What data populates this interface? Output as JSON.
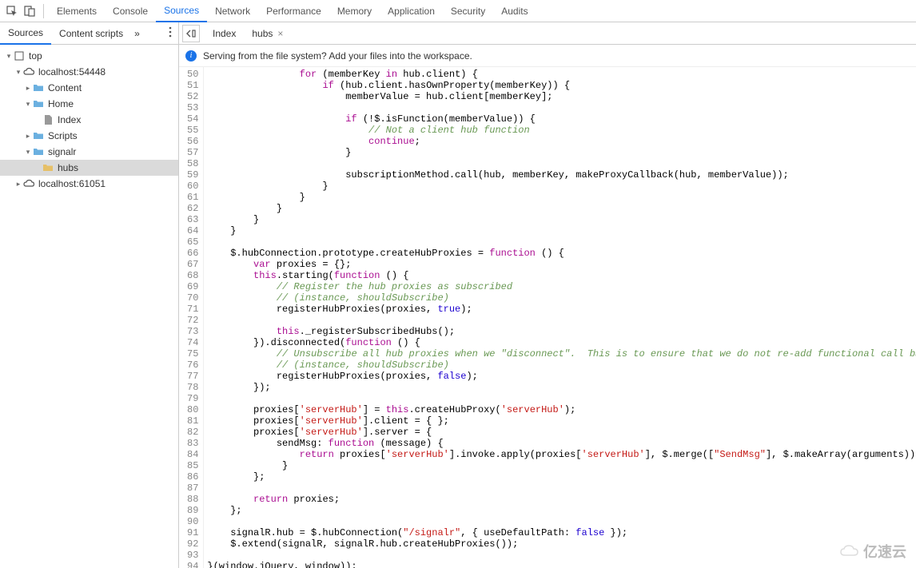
{
  "topbar": {
    "tabs": [
      "Elements",
      "Console",
      "Sources",
      "Network",
      "Performance",
      "Memory",
      "Application",
      "Security",
      "Audits"
    ],
    "active": "Sources"
  },
  "sidebar": {
    "tabs": [
      "Sources",
      "Content scripts"
    ],
    "active": "Sources",
    "more_glyph": "»",
    "tree": [
      {
        "label": "top",
        "indent": 0,
        "arrow": "▾",
        "icon": "frame"
      },
      {
        "label": "localhost:54448",
        "indent": 1,
        "arrow": "▾",
        "icon": "cloud"
      },
      {
        "label": "Content",
        "indent": 2,
        "arrow": "▸",
        "icon": "folder"
      },
      {
        "label": "Home",
        "indent": 2,
        "arrow": "▾",
        "icon": "folder"
      },
      {
        "label": "Index",
        "indent": 3,
        "arrow": "",
        "icon": "file"
      },
      {
        "label": "Scripts",
        "indent": 2,
        "arrow": "▸",
        "icon": "folder"
      },
      {
        "label": "signalr",
        "indent": 2,
        "arrow": "▾",
        "icon": "folder"
      },
      {
        "label": "hubs",
        "indent": 3,
        "arrow": "",
        "icon": "folder-y",
        "selected": true
      },
      {
        "label": "localhost:61051",
        "indent": 1,
        "arrow": "▸",
        "icon": "cloud"
      }
    ]
  },
  "editor": {
    "tabs": [
      {
        "label": "Index",
        "closable": false
      },
      {
        "label": "hubs",
        "closable": true
      }
    ],
    "info_bar": "Serving from the file system? Add your files into the workspace.",
    "first_line": 50,
    "lines": [
      [
        {
          "t": "                ",
          "c": "p"
        },
        {
          "t": "for",
          "c": "kw"
        },
        {
          "t": " (memberKey ",
          "c": "p"
        },
        {
          "t": "in",
          "c": "kw"
        },
        {
          "t": " hub.client) {",
          "c": "p"
        }
      ],
      [
        {
          "t": "                    ",
          "c": "p"
        },
        {
          "t": "if",
          "c": "kw"
        },
        {
          "t": " (hub.client.hasOwnProperty(memberKey)) {",
          "c": "p"
        }
      ],
      [
        {
          "t": "                        memberValue = hub.client[memberKey];",
          "c": "p"
        }
      ],
      [
        {
          "t": "",
          "c": "p"
        }
      ],
      [
        {
          "t": "                        ",
          "c": "p"
        },
        {
          "t": "if",
          "c": "kw"
        },
        {
          "t": " (!$.isFunction(memberValue)) {",
          "c": "p"
        }
      ],
      [
        {
          "t": "                            ",
          "c": "p"
        },
        {
          "t": "// Not a client hub function",
          "c": "cg"
        }
      ],
      [
        {
          "t": "                            ",
          "c": "p"
        },
        {
          "t": "continue",
          "c": "kw"
        },
        {
          "t": ";",
          "c": "p"
        }
      ],
      [
        {
          "t": "                        }",
          "c": "p"
        }
      ],
      [
        {
          "t": "",
          "c": "p"
        }
      ],
      [
        {
          "t": "                        subscriptionMethod.call(hub, memberKey, makeProxyCallback(hub, memberValue));",
          "c": "p"
        }
      ],
      [
        {
          "t": "                    }",
          "c": "p"
        }
      ],
      [
        {
          "t": "                }",
          "c": "p"
        }
      ],
      [
        {
          "t": "            }",
          "c": "p"
        }
      ],
      [
        {
          "t": "        }",
          "c": "p"
        }
      ],
      [
        {
          "t": "    }",
          "c": "p"
        }
      ],
      [
        {
          "t": "",
          "c": "p"
        }
      ],
      [
        {
          "t": "    $.hubConnection.prototype.createHubProxies = ",
          "c": "p"
        },
        {
          "t": "function",
          "c": "kw"
        },
        {
          "t": " () {",
          "c": "p"
        }
      ],
      [
        {
          "t": "        ",
          "c": "p"
        },
        {
          "t": "var",
          "c": "kw"
        },
        {
          "t": " proxies = {};",
          "c": "p"
        }
      ],
      [
        {
          "t": "        ",
          "c": "p"
        },
        {
          "t": "this",
          "c": "kw"
        },
        {
          "t": ".starting(",
          "c": "p"
        },
        {
          "t": "function",
          "c": "kw"
        },
        {
          "t": " () {",
          "c": "p"
        }
      ],
      [
        {
          "t": "            ",
          "c": "p"
        },
        {
          "t": "// Register the hub proxies as subscribed",
          "c": "cg"
        }
      ],
      [
        {
          "t": "            ",
          "c": "p"
        },
        {
          "t": "// (instance, shouldSubscribe)",
          "c": "cg"
        }
      ],
      [
        {
          "t": "            registerHubProxies(proxies, ",
          "c": "p"
        },
        {
          "t": "true",
          "c": "n"
        },
        {
          "t": ");",
          "c": "p"
        }
      ],
      [
        {
          "t": "",
          "c": "p"
        }
      ],
      [
        {
          "t": "            ",
          "c": "p"
        },
        {
          "t": "this",
          "c": "kw"
        },
        {
          "t": "._registerSubscribedHubs();",
          "c": "p"
        }
      ],
      [
        {
          "t": "        }).disconnected(",
          "c": "p"
        },
        {
          "t": "function",
          "c": "kw"
        },
        {
          "t": " () {",
          "c": "p"
        }
      ],
      [
        {
          "t": "            ",
          "c": "p"
        },
        {
          "t": "// Unsubscribe all hub proxies when we \"disconnect\".  This is to ensure that we do not re-add functional call backs.",
          "c": "cg"
        }
      ],
      [
        {
          "t": "            ",
          "c": "p"
        },
        {
          "t": "// (instance, shouldSubscribe)",
          "c": "cg"
        }
      ],
      [
        {
          "t": "            registerHubProxies(proxies, ",
          "c": "p"
        },
        {
          "t": "false",
          "c": "n"
        },
        {
          "t": ");",
          "c": "p"
        }
      ],
      [
        {
          "t": "        });",
          "c": "p"
        }
      ],
      [
        {
          "t": "",
          "c": "p"
        }
      ],
      [
        {
          "t": "        proxies[",
          "c": "p"
        },
        {
          "t": "'serverHub'",
          "c": "s"
        },
        {
          "t": "] = ",
          "c": "p"
        },
        {
          "t": "this",
          "c": "kw"
        },
        {
          "t": ".createHubProxy(",
          "c": "p"
        },
        {
          "t": "'serverHub'",
          "c": "s"
        },
        {
          "t": ");",
          "c": "p"
        }
      ],
      [
        {
          "t": "        proxies[",
          "c": "p"
        },
        {
          "t": "'serverHub'",
          "c": "s"
        },
        {
          "t": "].client = { };",
          "c": "p"
        }
      ],
      [
        {
          "t": "        proxies[",
          "c": "p"
        },
        {
          "t": "'serverHub'",
          "c": "s"
        },
        {
          "t": "].server = {",
          "c": "p"
        }
      ],
      [
        {
          "t": "            sendMsg: ",
          "c": "p"
        },
        {
          "t": "function",
          "c": "kw"
        },
        {
          "t": " (message) {",
          "c": "p"
        }
      ],
      [
        {
          "t": "                ",
          "c": "p"
        },
        {
          "t": "return",
          "c": "kw"
        },
        {
          "t": " proxies[",
          "c": "p"
        },
        {
          "t": "'serverHub'",
          "c": "s"
        },
        {
          "t": "].invoke.apply(proxies[",
          "c": "p"
        },
        {
          "t": "'serverHub'",
          "c": "s"
        },
        {
          "t": "], $.merge([",
          "c": "p"
        },
        {
          "t": "\"SendMsg\"",
          "c": "s"
        },
        {
          "t": "], $.makeArray(arguments)));",
          "c": "p"
        }
      ],
      [
        {
          "t": "             }",
          "c": "p"
        }
      ],
      [
        {
          "t": "        };",
          "c": "p"
        }
      ],
      [
        {
          "t": "",
          "c": "p"
        }
      ],
      [
        {
          "t": "        ",
          "c": "p"
        },
        {
          "t": "return",
          "c": "kw"
        },
        {
          "t": " proxies;",
          "c": "p"
        }
      ],
      [
        {
          "t": "    };",
          "c": "p"
        }
      ],
      [
        {
          "t": "",
          "c": "p"
        }
      ],
      [
        {
          "t": "    signalR.hub = $.hubConnection(",
          "c": "p"
        },
        {
          "t": "\"/signalr\"",
          "c": "s"
        },
        {
          "t": ", { useDefaultPath: ",
          "c": "p"
        },
        {
          "t": "false",
          "c": "n"
        },
        {
          "t": " });",
          "c": "p"
        }
      ],
      [
        {
          "t": "    $.extend(signalR, signalR.hub.createHubProxies());",
          "c": "p"
        }
      ],
      [
        {
          "t": "",
          "c": "p"
        }
      ],
      [
        {
          "t": "}(window.jQuery, window));",
          "c": "p"
        }
      ]
    ]
  },
  "watermark": "亿速云"
}
